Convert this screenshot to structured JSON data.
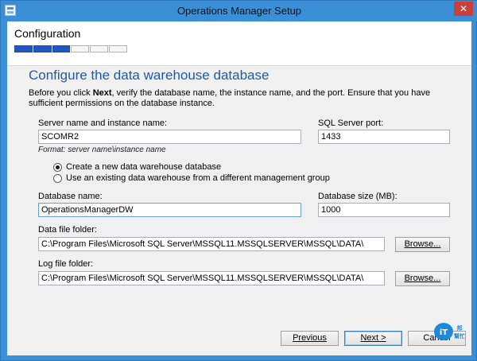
{
  "window": {
    "title": "Operations Manager Setup",
    "close_glyph": "✕"
  },
  "header": {
    "heading": "Configuration",
    "progress_steps_total": 6,
    "progress_steps_done": 3
  },
  "page": {
    "title": "Configure the data warehouse database",
    "description_prefix": "Before you click ",
    "description_bold": "Next",
    "description_suffix": ", verify the database name, the instance name, and the port. Ensure that you have sufficient permissions on the database instance."
  },
  "form": {
    "server_name": {
      "label": "Server name and instance name:",
      "value": "SCOMR2"
    },
    "sql_port": {
      "label": "SQL Server port:",
      "value": "1433"
    },
    "format_hint": "Format: server name\\instance name",
    "radio_new": {
      "label": "Create a new data warehouse database",
      "checked": true
    },
    "radio_existing": {
      "label": "Use an existing data warehouse from a different management group",
      "checked": false
    },
    "database_name": {
      "label": "Database name:",
      "value": "OperationsManagerDW"
    },
    "database_size": {
      "label": "Database size (MB):",
      "value": "1000"
    },
    "data_file_folder": {
      "label": "Data file folder:",
      "value": "C:\\Program Files\\Microsoft SQL Server\\MSSQL11.MSSQLSERVER\\MSSQL\\DATA\\",
      "browse_label": "Browse..."
    },
    "log_file_folder": {
      "label": "Log file folder:",
      "value": "C:\\Program Files\\Microsoft SQL Server\\MSSQL11.MSSQLSERVER\\MSSQL\\DATA\\",
      "browse_label": "Browse..."
    }
  },
  "footer": {
    "previous_label": "Previous",
    "next_label": "Next >",
    "cancel_label": "Cancel"
  },
  "watermark": {
    "text": "iT邦幫忙",
    "color": "#1e88d9"
  },
  "colors": {
    "accent": "#1c5ba8",
    "progress_fill": "#1f57c3",
    "title_bar": "#3a8fd6",
    "close_button": "#c9403a"
  }
}
